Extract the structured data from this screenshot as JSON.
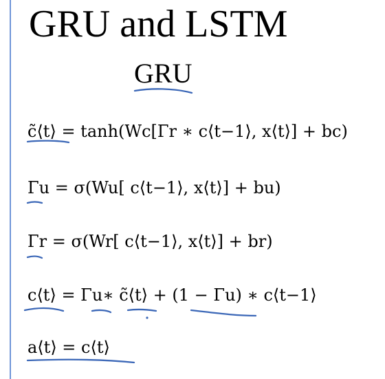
{
  "title": "GRU and LSTM",
  "subtitle": "GRU",
  "equations": [
    "c̃⟨t⟩ = tanh(Wc[Γr ∗ c⟨t−1⟩, x⟨t⟩] + bc)",
    "Γu = σ(Wu[ c⟨t−1⟩, x⟨t⟩] + bu)",
    "Γr = σ(Wr[ c⟨t−1⟩, x⟨t⟩] + br)",
    "c⟨t⟩ = Γu∗ c̃⟨t⟩ + (1 − Γu) ∗ c⟨t−1⟩",
    "a⟨t⟩ = c⟨t⟩"
  ],
  "colors": {
    "ink": "#3b67b7",
    "margin_line": "#6f95d8"
  }
}
